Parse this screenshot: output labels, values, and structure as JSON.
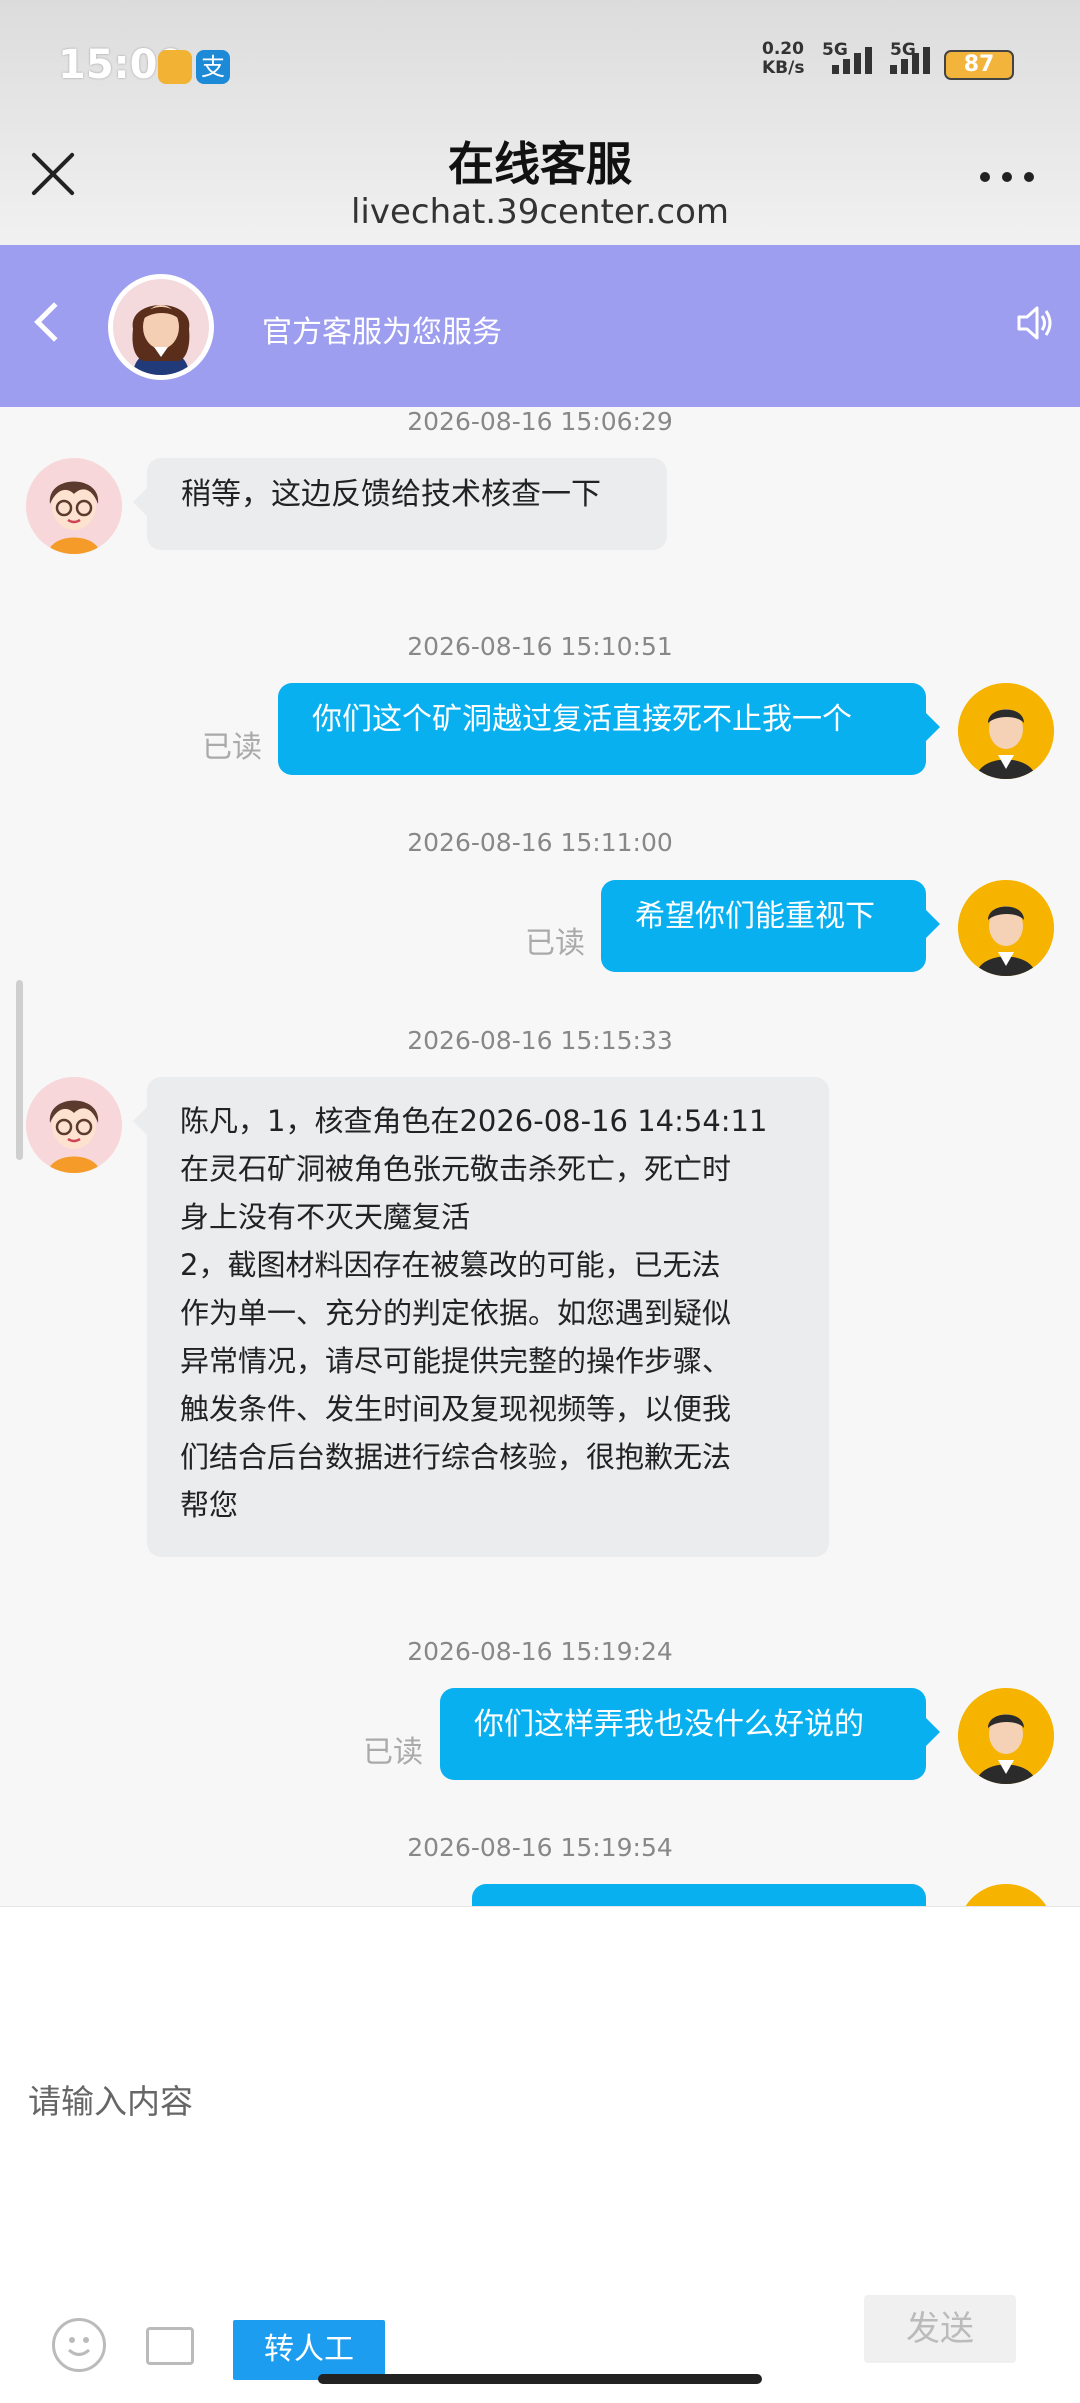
{
  "status_bar": {
    "time": "15:09",
    "net_speed": "0.20\nKB/s",
    "network_1": "5G",
    "network_2": "5G",
    "battery": "87",
    "app_icon_2": "支"
  },
  "browser": {
    "title": "在线客服",
    "url": "livechat.39center.com"
  },
  "chat_header": {
    "subtitle": "官方客服为您服务"
  },
  "messages": [
    {
      "side": "left",
      "timestamp": "2026-08-16 15:06:29",
      "text": "稍等，这边反馈给技术核查一下"
    },
    {
      "side": "right",
      "timestamp": "2026-08-16 15:10:51",
      "read": "已读",
      "text": "你们这个矿洞越过复活直接死不止我一个"
    },
    {
      "side": "right",
      "timestamp": "2026-08-16 15:11:00",
      "read": "已读",
      "text": "希望你们能重视下"
    },
    {
      "side": "left",
      "timestamp": "2026-08-16 15:15:33",
      "lines": [
        "陈凡，1，核查角色在2026-08-16 14:54:11",
        "在灵石矿洞被角色张元敬击杀死亡，死亡时",
        "身上没有不灭天魔复活",
        "2，截图材料因存在被篡改的可能，已无法",
        "作为单一、充分的判定依据。如您遇到疑似",
        "异常情况，请尽可能提供完整的操作步骤、",
        "触发条件、发生时间及复现视频等，以便我",
        "们结合后台数据进行综合核验，很抱歉无法",
        "帮您"
      ]
    },
    {
      "side": "right",
      "timestamp": "2026-08-16 15:19:24",
      "read": "已读",
      "text": "你们这样弄我也没什么好说的"
    },
    {
      "side": "right",
      "timestamp": "2026-08-16 15:19:54",
      "text": ""
    }
  ],
  "input": {
    "placeholder": "请输入内容",
    "transfer_label": "转人工",
    "send_label": "发送"
  },
  "colors": {
    "chat_header": "#9e9ef0",
    "user_bubble": "#09b0f0",
    "agent_bubble": "#ebecee",
    "transfer_button": "#1d9df0"
  }
}
